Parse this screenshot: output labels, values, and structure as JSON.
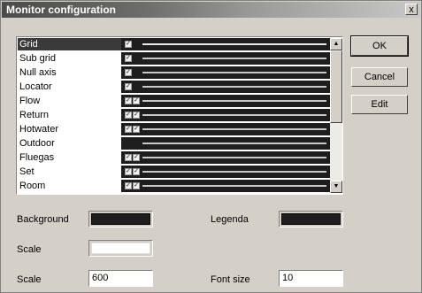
{
  "window": {
    "title": "Monitor configuration",
    "close_label": "x"
  },
  "list": {
    "items": [
      {
        "label": "Grid",
        "checks": [
          "✓"
        ],
        "selected": true
      },
      {
        "label": "Sub grid",
        "checks": [
          "✓"
        ]
      },
      {
        "label": "Null axis",
        "checks": [
          "✓"
        ]
      },
      {
        "label": "Locator",
        "checks": [
          "✓"
        ]
      },
      {
        "label": "Flow",
        "checks": [
          "✓",
          "✓"
        ]
      },
      {
        "label": "Return",
        "checks": [
          "✓",
          "✓"
        ]
      },
      {
        "label": "Hotwater",
        "checks": [
          "✓",
          "✓"
        ]
      },
      {
        "label": "Outdoor",
        "checks": []
      },
      {
        "label": "Fluegas",
        "checks": [
          "✓",
          "✓"
        ]
      },
      {
        "label": "Set",
        "checks": [
          "✓",
          "✓"
        ]
      },
      {
        "label": "Room",
        "checks": [
          "✓",
          "✓"
        ]
      }
    ],
    "scroll_up": "▲",
    "scroll_down": "▼"
  },
  "buttons": {
    "ok": "OK",
    "cancel": "Cancel",
    "edit": "Edit"
  },
  "fields": {
    "background_label": "Background",
    "legenda_label": "Legenda",
    "scale_color_label": "Scale",
    "scale_label": "Scale",
    "scale_value": "600",
    "font_size_label": "Font size",
    "font_size_value": "10"
  },
  "colors": {
    "background": "#1e1e1e",
    "legenda": "#1e1e1e",
    "scale": "#ffffff"
  }
}
